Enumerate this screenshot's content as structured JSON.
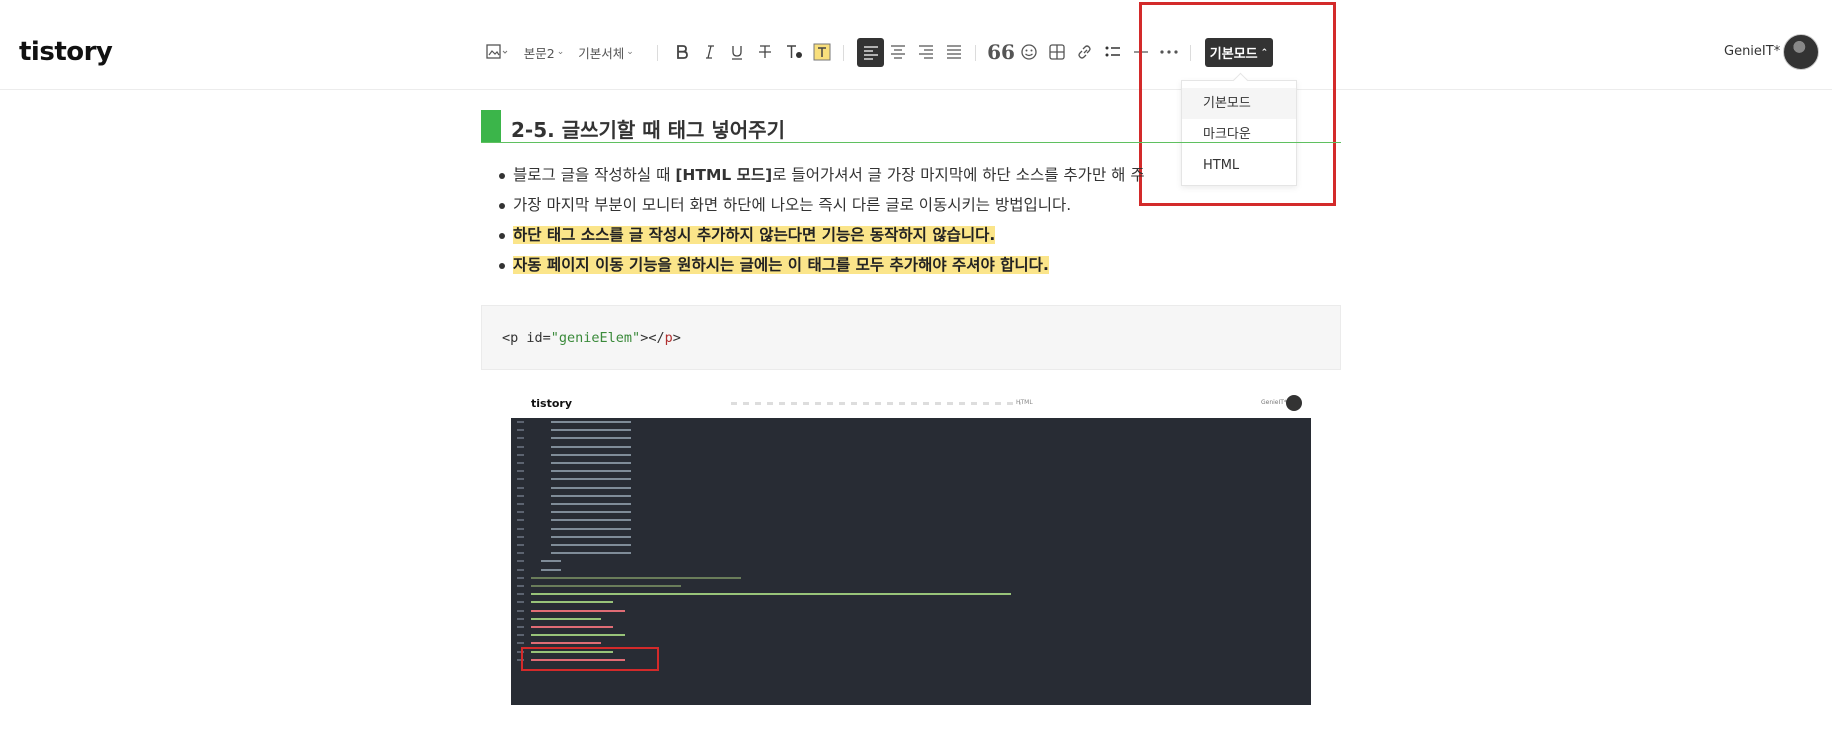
{
  "app": {
    "logo": "tistory",
    "user_name": "GenieIT*"
  },
  "toolbar": {
    "paragraph_style": "본문2",
    "font_family": "기본서체",
    "mode_button": "기본모드"
  },
  "mode_menu": {
    "items": [
      "기본모드",
      "마크다운",
      "HTML"
    ],
    "selected": "기본모드"
  },
  "content": {
    "heading": "2-5. 글쓰기할 때 태그 넣어주기",
    "bullets": [
      {
        "pre": "블로그 글을 작성하실 때 ",
        "bold": "[HTML 모드]",
        "post": "로 들어가셔서 글 가장 마지막에 하단 소스를 추가만 해 주"
      },
      {
        "text": "가장 마지막 부분이 모니터 화면 하단에 나오는 즉시 다른 글로 이동시키는 방법입니다."
      },
      {
        "highlight": "하단 태그 소스를 글 작성시 추가하지 않는다면 기능은 동작하지 않습니다."
      },
      {
        "highlight": "자동 페이지 이동 기능을 원하시는 글에는 이 태그를 모두 추가해야 주셔야 합니다."
      }
    ],
    "code": {
      "open": "<p id=",
      "value": "\"genieElem\"",
      "mid": "></",
      "tag": "p",
      "close": ">"
    }
  },
  "embedded_screenshot": {
    "logo": "tistory",
    "mode": "HTML",
    "user_name": "GenieIT*"
  },
  "colors": {
    "accent_green": "#3bb54a",
    "highlight": "#fbe58a",
    "annotation_red": "#d32a2a",
    "dark_button": "#333333"
  }
}
